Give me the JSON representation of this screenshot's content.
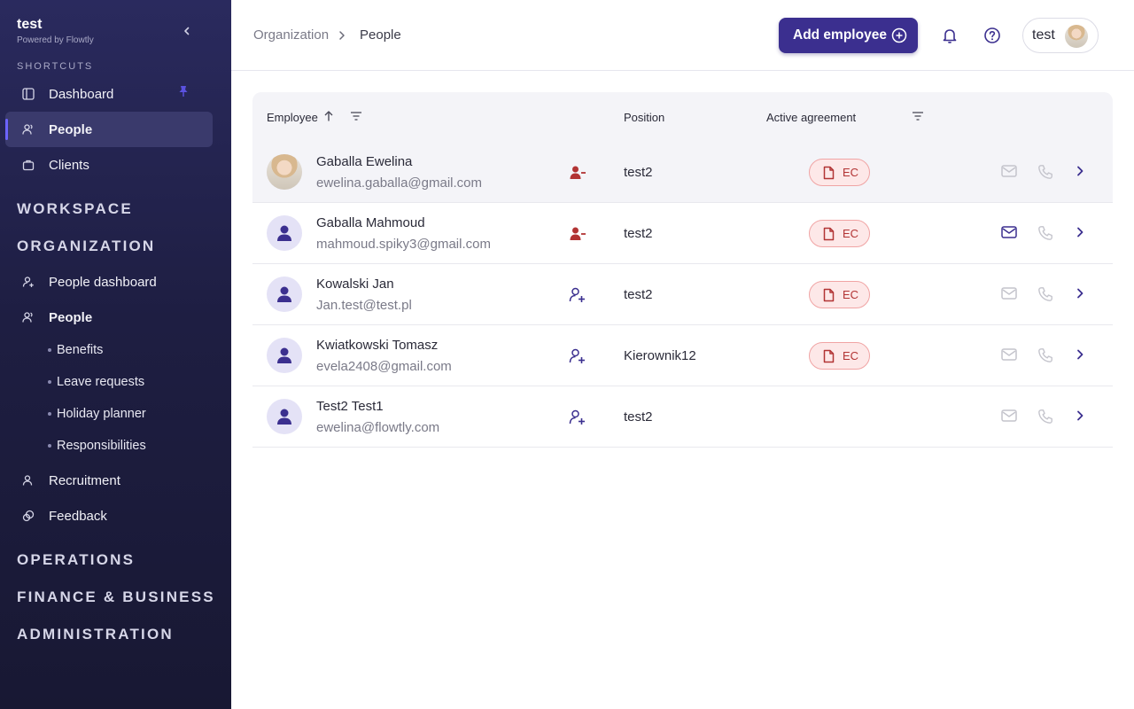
{
  "sidebar": {
    "title": "test",
    "powered_by": "Powered by Flowtly",
    "shortcuts_label": "SHORTCUTS",
    "shortcuts": [
      {
        "label": "Dashboard",
        "icon": "layout-icon",
        "pinned": true
      },
      {
        "label": "People",
        "icon": "people-icon",
        "active": true
      },
      {
        "label": "Clients",
        "icon": "briefcase-icon"
      }
    ],
    "sections": {
      "workspace": "WORKSPACE",
      "organization": "ORGANIZATION",
      "operations": "OPERATIONS",
      "finance": "FINANCE & BUSINESS",
      "administration": "ADMINISTRATION"
    },
    "org_items": [
      {
        "label": "People dashboard",
        "icon": "user-plus-icon"
      },
      {
        "label": "People",
        "icon": "people-icon"
      },
      {
        "label": "Recruitment",
        "icon": "user-search-icon"
      },
      {
        "label": "Feedback",
        "icon": "feedback-icon"
      }
    ],
    "people_sub": [
      "Benefits",
      "Leave requests",
      "Holiday planner",
      "Responsibilities"
    ]
  },
  "header": {
    "breadcrumb": [
      "Organization",
      "People"
    ],
    "add_button": "Add employee",
    "user_name": "test"
  },
  "table": {
    "columns": {
      "employee": "Employee",
      "position": "Position",
      "agreement": "Active agreement"
    },
    "rows": [
      {
        "name": "Gaballa Ewelina",
        "email": "ewelina.gaballa@gmail.com",
        "status": "inactive",
        "position": "test2",
        "agreement": "EC",
        "has_photo": true,
        "mail_active": false
      },
      {
        "name": "Gaballa Mahmoud",
        "email": "mahmoud.spiky3@gmail.com",
        "status": "inactive",
        "position": "test2",
        "agreement": "EC",
        "has_photo": false,
        "mail_active": true
      },
      {
        "name": "Kowalski Jan",
        "email": "Jan.test@test.pl",
        "status": "active",
        "position": "test2",
        "agreement": "EC",
        "has_photo": false,
        "mail_active": false
      },
      {
        "name": "Kwiatkowski Tomasz",
        "email": "evela2408@gmail.com",
        "status": "active",
        "position": "Kierownik12",
        "agreement": "EC",
        "has_photo": false,
        "mail_active": false
      },
      {
        "name": "Test2 Test1",
        "email": "ewelina@flowtly.com",
        "status": "active",
        "position": "test2",
        "agreement": "",
        "has_photo": false,
        "mail_active": false
      }
    ]
  },
  "colors": {
    "sidebar_bg": "#23234f",
    "accent": "#3b2f8f",
    "danger": "#b23434"
  }
}
